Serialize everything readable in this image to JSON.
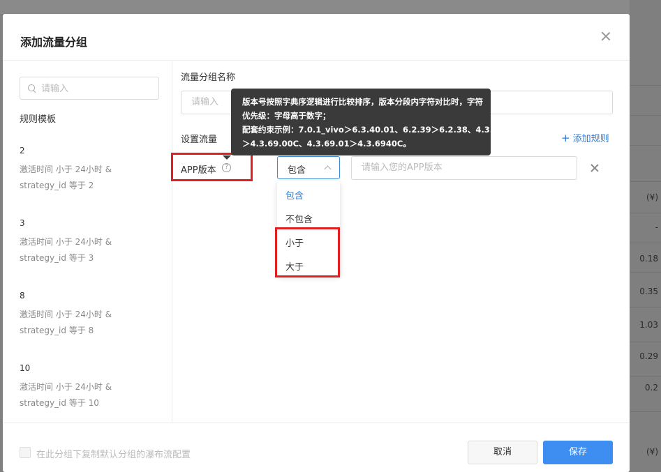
{
  "background": {
    "cells": [
      "(¥)",
      "-",
      "0.18",
      "0.35",
      "1.03",
      "0.29",
      "0.2",
      "(¥)"
    ]
  },
  "modal": {
    "title": "添加流量分组",
    "left": {
      "search_placeholder": "请输入",
      "section_title": "规则模板",
      "templates": [
        {
          "id": "2",
          "desc_line1": "激活时间 小于 24小时 &",
          "desc_line2": "strategy_id 等于 2"
        },
        {
          "id": "3",
          "desc_line1": "激活时间 小于 24小时 &",
          "desc_line2": "strategy_id 等于 3"
        },
        {
          "id": "8",
          "desc_line1": "激活时间 小于 24小时 &",
          "desc_line2": "strategy_id 等于 8"
        },
        {
          "id": "10",
          "desc_line1": "激活时间 小于 24小时 &",
          "desc_line2": "strategy_id 等于 10"
        }
      ]
    },
    "form": {
      "name_label": "流量分组名称",
      "name_placeholder": "请输入",
      "rules_label": "设置流量",
      "add_rule": "添加规则",
      "rule": {
        "field": "APP版本",
        "operator": "包含",
        "value_placeholder": "请输入您的APP版本"
      },
      "operator_options": [
        "包含",
        "不包含",
        "小于",
        "大于"
      ]
    },
    "tooltip": {
      "line1": "版本号按照字典序逻辑进行比较排序，版本分段内字符对比时，字符",
      "line2": "优先级：字母高于数字；",
      "line3": "配套约束示例：7.0.1_vivo＞6.3.40.01、6.2.39＞6.2.38、4.3.69.01",
      "line4": "＞4.3.69.00C、4.3.69.01＞4.3.6940C。"
    },
    "footer": {
      "checkbox_label": "在此分组下复制默认分组的瀑布流配置",
      "cancel": "取消",
      "save": "保存"
    }
  },
  "colors": {
    "accent": "#3d8ef0",
    "link": "#2d7bd5",
    "highlight": "#e02020",
    "tooltip_bg": "#3a3a3a"
  }
}
